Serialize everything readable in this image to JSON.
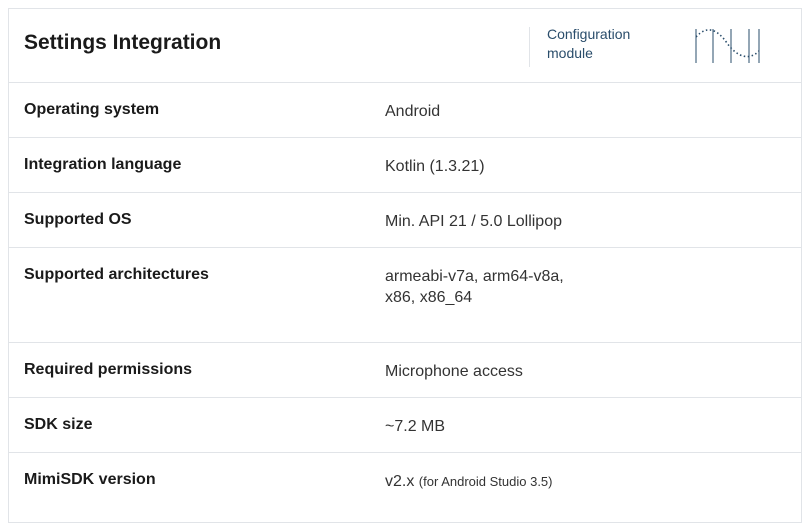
{
  "header": {
    "title": "Settings Integration",
    "subtitle_line1": "Configuration",
    "subtitle_line2": "module",
    "logo": "waveform-logo-icon"
  },
  "rows": [
    {
      "label": "Operating system",
      "value": "Android"
    },
    {
      "label": "Integration language",
      "value": "Kotlin (1.3.21)"
    },
    {
      "label": "Supported OS",
      "value": "Min. API 21 / 5.0 Lollipop"
    },
    {
      "label": "Supported architectures",
      "value_line1": "armeabi-v7a, arm64-v8a,",
      "value_line2": "x86, x86_64"
    },
    {
      "label": "Required permissions",
      "value": "Microphone access"
    },
    {
      "label": "SDK size",
      "value": "~7.2 MB"
    },
    {
      "label": "MimiSDK version",
      "value_main": "v2.x",
      "value_note": "(for Android Studio 3.5)"
    }
  ],
  "colors": {
    "accent": "#2a4d6b",
    "border": "#e1e4e8"
  }
}
